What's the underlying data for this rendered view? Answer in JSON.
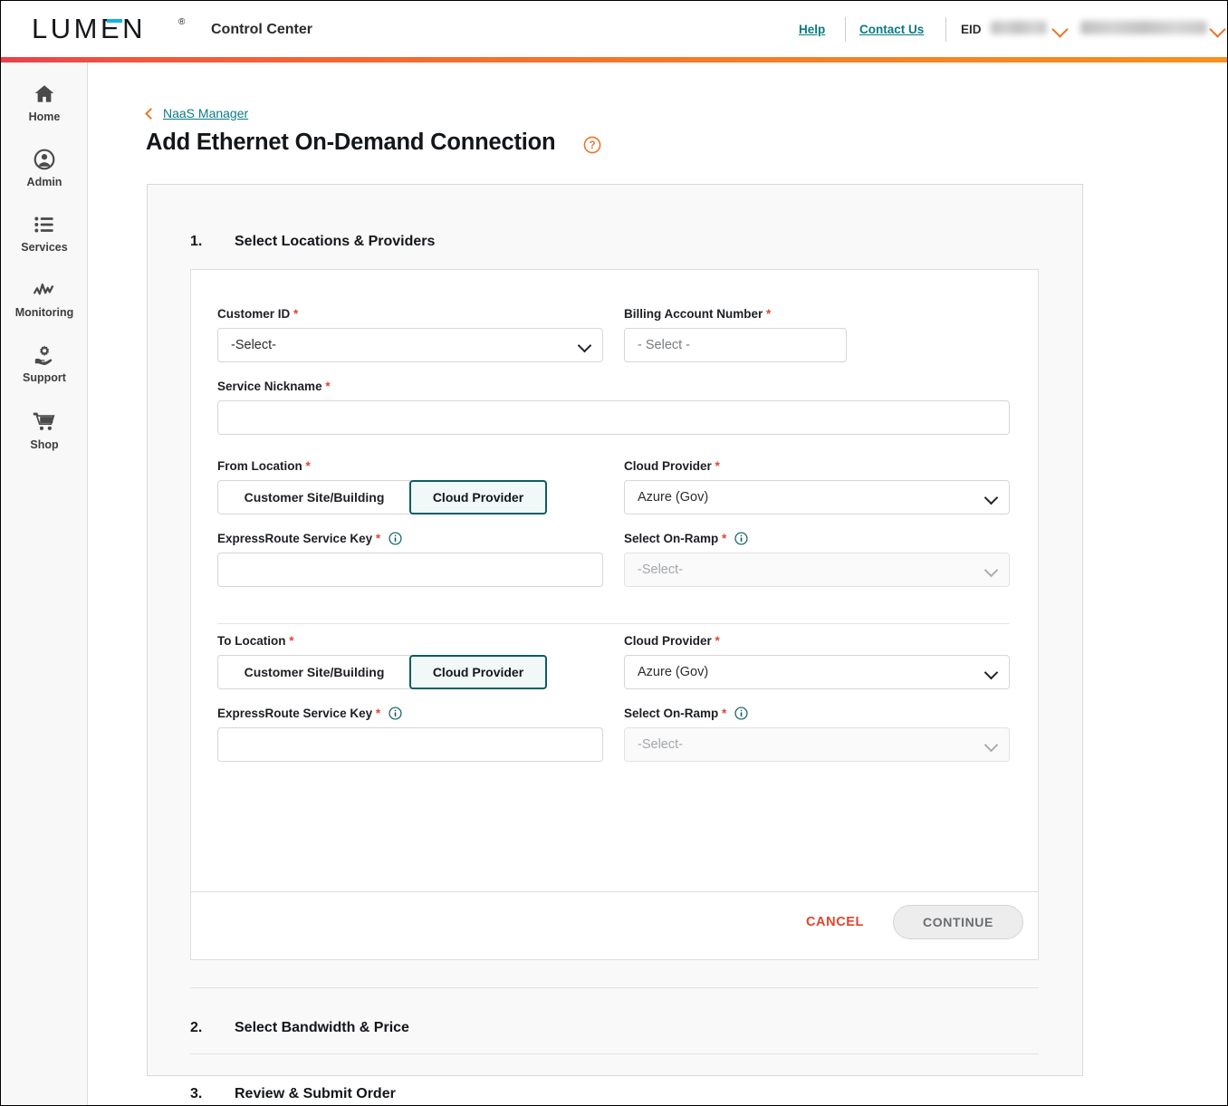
{
  "header": {
    "logo_text": "LUMEN",
    "logo_registered": "®",
    "app_title": "Control Center",
    "help_label": "Help",
    "contact_label": "Contact Us",
    "eid_label": "EID",
    "eid_value": "",
    "account_value": ""
  },
  "sidebar": {
    "items": [
      {
        "label": "Home",
        "icon": "home-icon"
      },
      {
        "label": "Admin",
        "icon": "account-circle-icon"
      },
      {
        "label": "Services",
        "icon": "list-icon"
      },
      {
        "label": "Monitoring",
        "icon": "activity-wave-icon"
      },
      {
        "label": "Support",
        "icon": "support-gear-hand-icon"
      },
      {
        "label": "Shop",
        "icon": "shopping-cart-icon"
      }
    ]
  },
  "breadcrumb": {
    "label": "NaaS Manager",
    "icon": "chevron-left-icon"
  },
  "page": {
    "title": "Add Ethernet On-Demand Connection",
    "help_icon": "question-circle-icon"
  },
  "steps": [
    {
      "number": "1.",
      "title": "Select Locations & Providers"
    },
    {
      "number": "2.",
      "title": "Select Bandwidth & Price"
    },
    {
      "number": "3.",
      "title": "Review & Submit Order"
    }
  ],
  "form": {
    "customer_id": {
      "label": "Customer ID",
      "required": "*",
      "value": "-Select-",
      "icon": "chevron-down-icon"
    },
    "billing_account": {
      "label": "Billing Account Number",
      "required": "*",
      "placeholder": "- Select -",
      "value": ""
    },
    "service_nickname": {
      "label": "Service Nickname",
      "required": "*",
      "value": "",
      "placeholder": ""
    },
    "from_location": {
      "label": "From Location",
      "required": "*",
      "option_site": "Customer Site/Building",
      "option_cloud": "Cloud Provider",
      "selected": "Cloud Provider"
    },
    "from_cloud_provider": {
      "label": "Cloud Provider",
      "required": "*",
      "value": "Azure (Gov)",
      "icon": "chevron-down-icon"
    },
    "from_service_key": {
      "label": "ExpressRoute Service Key",
      "required": "*",
      "value": "",
      "info_icon": "info-circle-icon"
    },
    "from_onramp": {
      "label": "Select On-Ramp",
      "required": "*",
      "value": "-Select-",
      "info_icon": "info-circle-icon",
      "icon": "chevron-down-icon",
      "disabled": true
    },
    "to_location": {
      "label": "To Location",
      "required": "*",
      "option_site": "Customer Site/Building",
      "option_cloud": "Cloud Provider",
      "selected": "Cloud Provider"
    },
    "to_cloud_provider": {
      "label": "Cloud Provider",
      "required": "*",
      "value": "Azure (Gov)",
      "icon": "chevron-down-icon"
    },
    "to_service_key": {
      "label": "ExpressRoute Service Key",
      "required": "*",
      "value": "",
      "info_icon": "info-circle-icon"
    },
    "to_onramp": {
      "label": "Select On-Ramp",
      "required": "*",
      "value": "-Select-",
      "info_icon": "info-circle-icon",
      "icon": "chevron-down-icon",
      "disabled": true
    }
  },
  "actions": {
    "cancel_label": "CANCEL",
    "continue_label": "CONTINUE"
  },
  "colors": {
    "brand_orange": "#f4712e",
    "brand_red": "#e8414e",
    "link_teal": "#0b7b84",
    "toggle_selected_border": "#0b5e63",
    "toggle_selected_fill": "#f0f9f8",
    "required_red": "#e0452c",
    "logo_blue": "#0fb3e5"
  }
}
